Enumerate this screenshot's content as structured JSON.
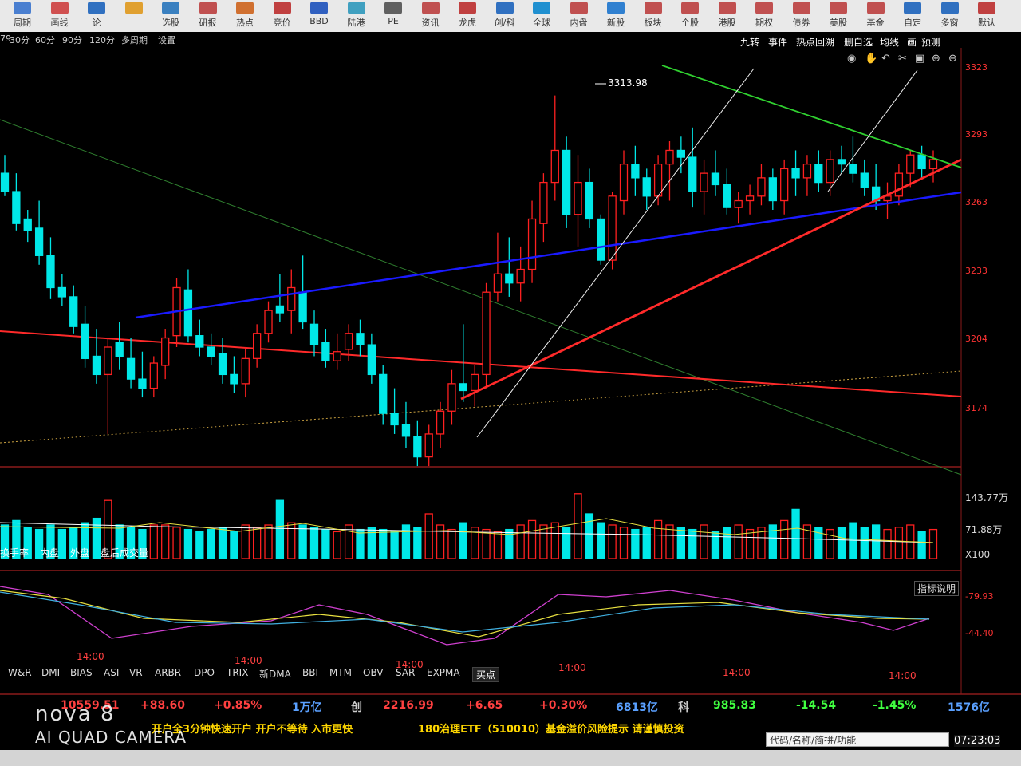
{
  "toolbar": {
    "items": [
      {
        "label": "周期",
        "color": "#4a7fd0"
      },
      {
        "label": "画线",
        "color": "#d05050"
      },
      {
        "label": "论",
        "color": "#3070c0"
      },
      {
        "label": "",
        "color": "#e0a030"
      },
      {
        "label": "选股",
        "color": "#3a80c0"
      },
      {
        "label": "研报",
        "color": "#c05050"
      },
      {
        "label": "热点",
        "color": "#d07030"
      },
      {
        "label": "竞价",
        "color": "#c04040"
      },
      {
        "label": "BBD",
        "color": "#3060c0"
      },
      {
        "label": "陆港",
        "color": "#40a0c0"
      },
      {
        "label": "PE",
        "color": "#606060"
      },
      {
        "label": "资讯",
        "color": "#c05050"
      },
      {
        "label": "龙虎",
        "color": "#c04040"
      },
      {
        "label": "创/科",
        "color": "#3070c0"
      },
      {
        "label": "全球",
        "color": "#2090d0"
      },
      {
        "label": "内盘",
        "color": "#c05050"
      },
      {
        "label": "新股",
        "color": "#3080d0"
      },
      {
        "label": "板块",
        "color": "#c05050"
      },
      {
        "label": "个股",
        "color": "#c05050"
      },
      {
        "label": "港股",
        "color": "#c05050"
      },
      {
        "label": "期权",
        "color": "#c05050"
      },
      {
        "label": "债券",
        "color": "#c05050"
      },
      {
        "label": "美股",
        "color": "#c05050"
      },
      {
        "label": "基金",
        "color": "#c05050"
      },
      {
        "label": "自定",
        "color": "#3070c0"
      },
      {
        "label": "多窗",
        "color": "#3070c0"
      },
      {
        "label": "默认",
        "color": "#c04040"
      }
    ]
  },
  "periods": [
    "79",
    "30分",
    "60分",
    "90分",
    "120分",
    "多周期",
    "设置"
  ],
  "right_tools": [
    "九转",
    "事件",
    "热点回溯",
    "删自选",
    "均线",
    "画",
    "预测"
  ],
  "price_axis": [
    "3323",
    "3293",
    "3263",
    "3233",
    "3204",
    "3174"
  ],
  "peak_label": "3313.98",
  "volume_axis": [
    "143.77万",
    "71.88万",
    "X100"
  ],
  "osc_axis": [
    "-79.93",
    "-44.40"
  ],
  "volume_tabs": [
    "换手率",
    "内盘",
    "外盘",
    "盘后成交量"
  ],
  "indicator_tabs": [
    "W&R",
    "DMI",
    "BIAS",
    "ASI",
    "VR",
    "ARBR",
    "DPO",
    "TRIX",
    "新DMA",
    "BBI",
    "MTM",
    "OBV",
    "SAR",
    "EXPMA",
    "买点"
  ],
  "indicator_help": "指标说明",
  "time_labels": [
    "14:00",
    "14:00",
    "14:00",
    "14:00",
    "14:00",
    "14:00"
  ],
  "quotes": [
    {
      "text": "10559.51",
      "color": "#ff4040"
    },
    {
      "text": "+88.60",
      "color": "#ff4040"
    },
    {
      "text": "+0.85%",
      "color": "#ff4040"
    },
    {
      "text": "1万亿",
      "color": "#5aa0ff"
    },
    {
      "text": "创",
      "color": "#cccccc"
    },
    {
      "text": "2216.99",
      "color": "#ff4040"
    },
    {
      "text": "+6.65",
      "color": "#ff4040"
    },
    {
      "text": "+0.30%",
      "color": "#ff4040"
    },
    {
      "text": "6813亿",
      "color": "#5aa0ff"
    },
    {
      "text": "科",
      "color": "#cccccc"
    },
    {
      "text": "985.83",
      "color": "#40ff40"
    },
    {
      "text": "-14.54",
      "color": "#40ff40"
    },
    {
      "text": "-1.45%",
      "color": "#40ff40"
    },
    {
      "text": "1576亿",
      "color": "#5aa0ff"
    }
  ],
  "ticker_left": "开户全3分钟快速开户  开户不等待  入市更快",
  "ticker_right": "180治理ETF（510010）基金溢价风险提示  请谨慎投资",
  "search_placeholder": "代码/名称/简拼/功能",
  "clock": "07:23:03",
  "watermark_line1": "nova 8",
  "watermark_line2": "AI QUAD CAMERA",
  "colors": {
    "up": "#ff2020",
    "down": "#00e8e8",
    "trend_blue": "#1a1aff",
    "trend_red": "#ff2a2a",
    "trend_green": "#30d030"
  }
}
